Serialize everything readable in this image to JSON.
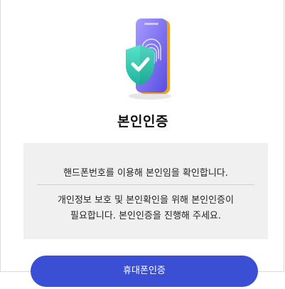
{
  "page": {
    "title": "본인인증"
  },
  "info": {
    "line1": "핸드폰번호를 이용해 본인임을 확인합니다.",
    "paragraph": [
      "개인정보 보호 및 본인확인을 위해 본인인증이",
      "필요합니다. 본인인증을 진행해 주세요."
    ]
  },
  "action": {
    "button_label": "휴대폰인증"
  },
  "colors": {
    "accent": "#3a4fd3",
    "info_bg": "#f0f0f0",
    "phone": "#7b6ff0",
    "phone_frame": "#f0a21c",
    "shield": "#2ec7b0"
  },
  "icons": {
    "illustration": "phone-fingerprint-shield-icon"
  }
}
